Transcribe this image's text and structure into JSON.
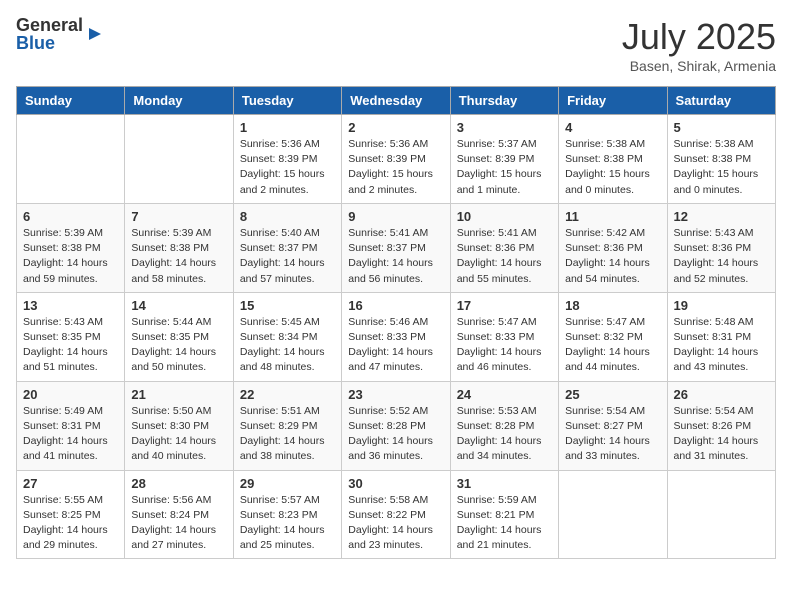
{
  "logo": {
    "general": "General",
    "blue": "Blue"
  },
  "title": {
    "month_year": "July 2025",
    "location": "Basen, Shirak, Armenia"
  },
  "days": [
    "Sunday",
    "Monday",
    "Tuesday",
    "Wednesday",
    "Thursday",
    "Friday",
    "Saturday"
  ],
  "weeks": [
    [
      {
        "day": "",
        "content": ""
      },
      {
        "day": "",
        "content": ""
      },
      {
        "day": "1",
        "content": "Sunrise: 5:36 AM\nSunset: 8:39 PM\nDaylight: 15 hours and 2 minutes."
      },
      {
        "day": "2",
        "content": "Sunrise: 5:36 AM\nSunset: 8:39 PM\nDaylight: 15 hours and 2 minutes."
      },
      {
        "day": "3",
        "content": "Sunrise: 5:37 AM\nSunset: 8:39 PM\nDaylight: 15 hours and 1 minute."
      },
      {
        "day": "4",
        "content": "Sunrise: 5:38 AM\nSunset: 8:38 PM\nDaylight: 15 hours and 0 minutes."
      },
      {
        "day": "5",
        "content": "Sunrise: 5:38 AM\nSunset: 8:38 PM\nDaylight: 15 hours and 0 minutes."
      }
    ],
    [
      {
        "day": "6",
        "content": "Sunrise: 5:39 AM\nSunset: 8:38 PM\nDaylight: 14 hours and 59 minutes."
      },
      {
        "day": "7",
        "content": "Sunrise: 5:39 AM\nSunset: 8:38 PM\nDaylight: 14 hours and 58 minutes."
      },
      {
        "day": "8",
        "content": "Sunrise: 5:40 AM\nSunset: 8:37 PM\nDaylight: 14 hours and 57 minutes."
      },
      {
        "day": "9",
        "content": "Sunrise: 5:41 AM\nSunset: 8:37 PM\nDaylight: 14 hours and 56 minutes."
      },
      {
        "day": "10",
        "content": "Sunrise: 5:41 AM\nSunset: 8:36 PM\nDaylight: 14 hours and 55 minutes."
      },
      {
        "day": "11",
        "content": "Sunrise: 5:42 AM\nSunset: 8:36 PM\nDaylight: 14 hours and 54 minutes."
      },
      {
        "day": "12",
        "content": "Sunrise: 5:43 AM\nSunset: 8:36 PM\nDaylight: 14 hours and 52 minutes."
      }
    ],
    [
      {
        "day": "13",
        "content": "Sunrise: 5:43 AM\nSunset: 8:35 PM\nDaylight: 14 hours and 51 minutes."
      },
      {
        "day": "14",
        "content": "Sunrise: 5:44 AM\nSunset: 8:35 PM\nDaylight: 14 hours and 50 minutes."
      },
      {
        "day": "15",
        "content": "Sunrise: 5:45 AM\nSunset: 8:34 PM\nDaylight: 14 hours and 48 minutes."
      },
      {
        "day": "16",
        "content": "Sunrise: 5:46 AM\nSunset: 8:33 PM\nDaylight: 14 hours and 47 minutes."
      },
      {
        "day": "17",
        "content": "Sunrise: 5:47 AM\nSunset: 8:33 PM\nDaylight: 14 hours and 46 minutes."
      },
      {
        "day": "18",
        "content": "Sunrise: 5:47 AM\nSunset: 8:32 PM\nDaylight: 14 hours and 44 minutes."
      },
      {
        "day": "19",
        "content": "Sunrise: 5:48 AM\nSunset: 8:31 PM\nDaylight: 14 hours and 43 minutes."
      }
    ],
    [
      {
        "day": "20",
        "content": "Sunrise: 5:49 AM\nSunset: 8:31 PM\nDaylight: 14 hours and 41 minutes."
      },
      {
        "day": "21",
        "content": "Sunrise: 5:50 AM\nSunset: 8:30 PM\nDaylight: 14 hours and 40 minutes."
      },
      {
        "day": "22",
        "content": "Sunrise: 5:51 AM\nSunset: 8:29 PM\nDaylight: 14 hours and 38 minutes."
      },
      {
        "day": "23",
        "content": "Sunrise: 5:52 AM\nSunset: 8:28 PM\nDaylight: 14 hours and 36 minutes."
      },
      {
        "day": "24",
        "content": "Sunrise: 5:53 AM\nSunset: 8:28 PM\nDaylight: 14 hours and 34 minutes."
      },
      {
        "day": "25",
        "content": "Sunrise: 5:54 AM\nSunset: 8:27 PM\nDaylight: 14 hours and 33 minutes."
      },
      {
        "day": "26",
        "content": "Sunrise: 5:54 AM\nSunset: 8:26 PM\nDaylight: 14 hours and 31 minutes."
      }
    ],
    [
      {
        "day": "27",
        "content": "Sunrise: 5:55 AM\nSunset: 8:25 PM\nDaylight: 14 hours and 29 minutes."
      },
      {
        "day": "28",
        "content": "Sunrise: 5:56 AM\nSunset: 8:24 PM\nDaylight: 14 hours and 27 minutes."
      },
      {
        "day": "29",
        "content": "Sunrise: 5:57 AM\nSunset: 8:23 PM\nDaylight: 14 hours and 25 minutes."
      },
      {
        "day": "30",
        "content": "Sunrise: 5:58 AM\nSunset: 8:22 PM\nDaylight: 14 hours and 23 minutes."
      },
      {
        "day": "31",
        "content": "Sunrise: 5:59 AM\nSunset: 8:21 PM\nDaylight: 14 hours and 21 minutes."
      },
      {
        "day": "",
        "content": ""
      },
      {
        "day": "",
        "content": ""
      }
    ]
  ]
}
